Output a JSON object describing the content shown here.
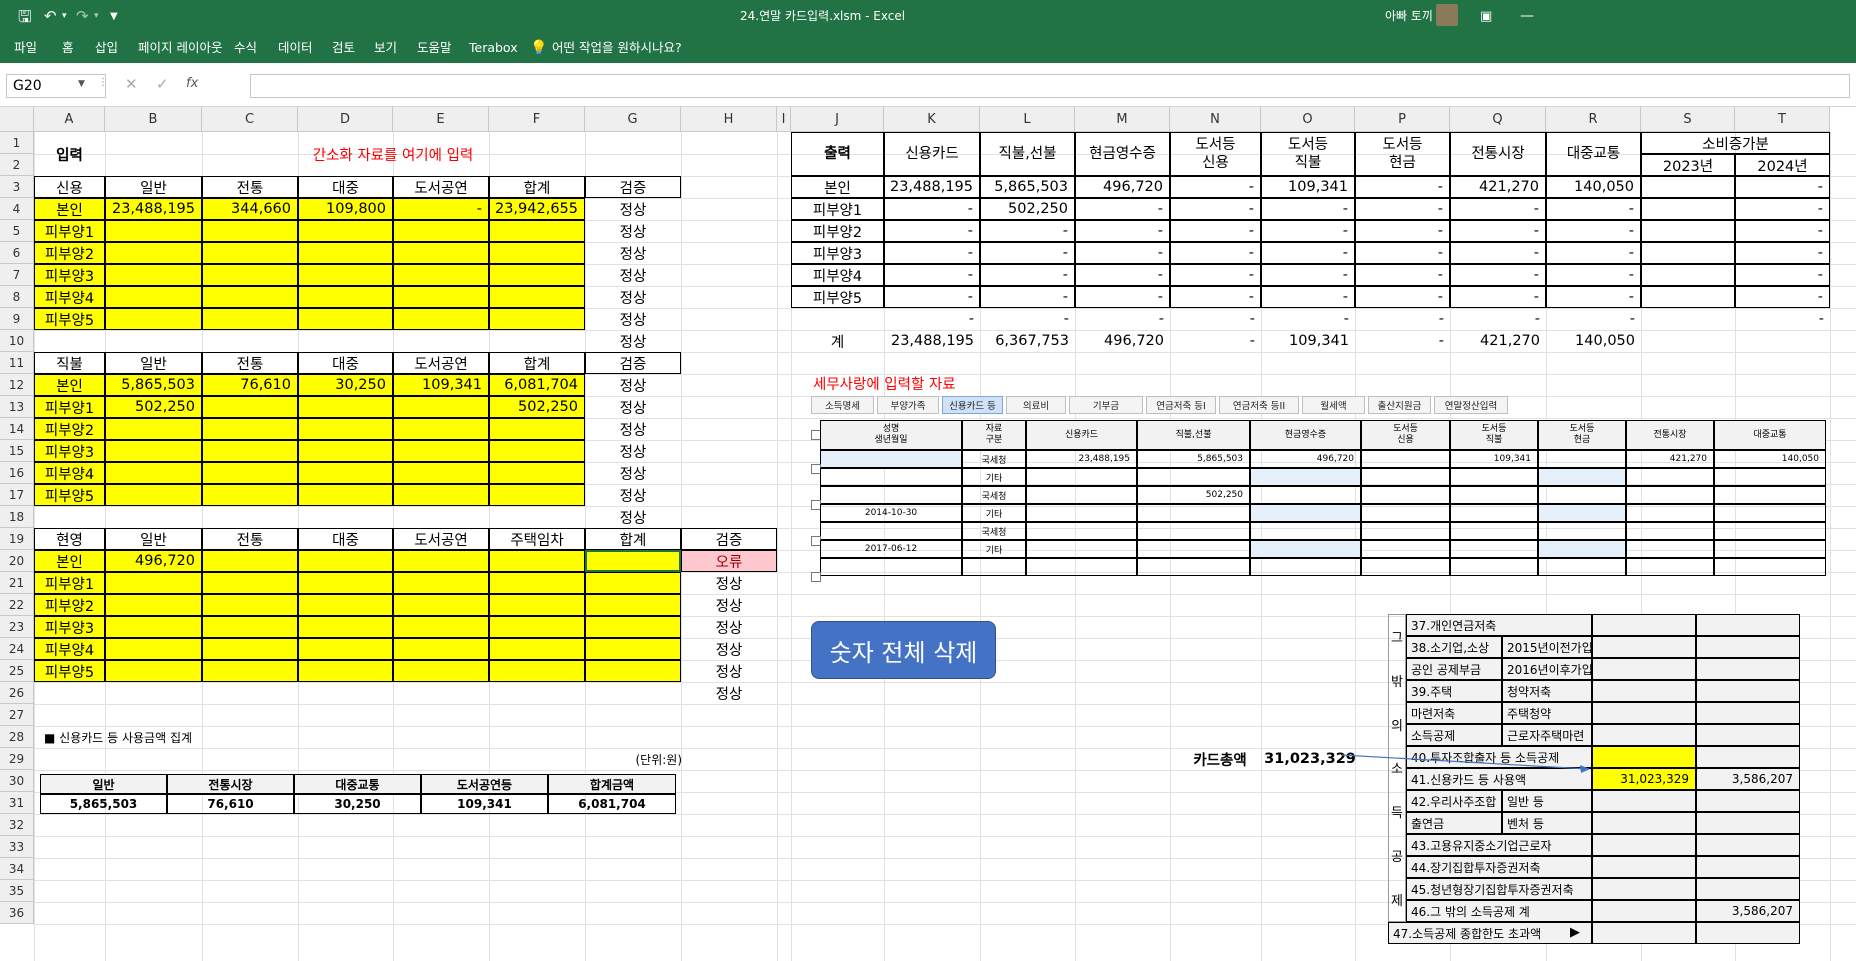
{
  "window": {
    "filename": "24.연말 카드입력.xlsm - Excel",
    "user": "아빠 토끼"
  },
  "ribbon": {
    "tabs": [
      "파일",
      "홈",
      "삽입",
      "페이지 레이아웃",
      "수식",
      "데이터",
      "검토",
      "보기",
      "도움말",
      "Terabox"
    ],
    "tell_me": "어떤 작업을 원하시나요?"
  },
  "formula_bar": {
    "name_box": "G20",
    "fx": "fx",
    "value": ""
  },
  "columns": [
    "A",
    "B",
    "C",
    "D",
    "E",
    "F",
    "G",
    "H",
    "I",
    "J",
    "K",
    "L",
    "M",
    "N",
    "O",
    "P",
    "Q",
    "R",
    "S",
    "T"
  ],
  "rows": [
    "1",
    "2",
    "3",
    "4",
    "5",
    "6",
    "7",
    "8",
    "9",
    "10",
    "11",
    "12",
    "13",
    "14",
    "15",
    "16",
    "17",
    "18",
    "19",
    "20",
    "21",
    "22",
    "23",
    "24",
    "25",
    "26",
    "27",
    "28",
    "29",
    "30",
    "31",
    "32",
    "33",
    "34",
    "35",
    "36"
  ],
  "left": {
    "title_label": "입력",
    "title_note": "간소화 자료를 여기에 입력",
    "t1": {
      "headers": [
        "신용",
        "일반",
        "전통",
        "대중",
        "도서공연",
        "합계",
        "검증"
      ],
      "rows": [
        [
          "본인",
          "23,488,195",
          "344,660",
          "109,800",
          "-",
          "23,942,655",
          "정상"
        ],
        [
          "피부양1",
          "",
          "",
          "",
          "",
          "",
          "정상"
        ],
        [
          "피부양2",
          "",
          "",
          "",
          "",
          "",
          "정상"
        ],
        [
          "피부양3",
          "",
          "",
          "",
          "",
          "",
          "정상"
        ],
        [
          "피부양4",
          "",
          "",
          "",
          "",
          "",
          "정상"
        ],
        [
          "피부양5",
          "",
          "",
          "",
          "",
          "",
          "정상"
        ]
      ],
      "extra": "정상"
    },
    "t2": {
      "headers": [
        "직불",
        "일반",
        "전통",
        "대중",
        "도서공연",
        "합계",
        "검증"
      ],
      "rows": [
        [
          "본인",
          "5,865,503",
          "76,610",
          "30,250",
          "109,341",
          "6,081,704",
          "정상"
        ],
        [
          "피부양1",
          "502,250",
          "",
          "",
          "",
          "502,250",
          "정상"
        ],
        [
          "피부양2",
          "",
          "",
          "",
          "",
          "",
          "정상"
        ],
        [
          "피부양3",
          "",
          "",
          "",
          "",
          "",
          "정상"
        ],
        [
          "피부양4",
          "",
          "",
          "",
          "",
          "",
          "정상"
        ],
        [
          "피부양5",
          "",
          "",
          "",
          "",
          "",
          "정상"
        ]
      ],
      "extra": "정상"
    },
    "t3": {
      "headers": [
        "현영",
        "일반",
        "전통",
        "대중",
        "도서공연",
        "주택임차",
        "합계",
        "검증"
      ],
      "rows": [
        [
          "본인",
          "496,720",
          "",
          "",
          "",
          "",
          "",
          "오류"
        ],
        [
          "피부양1",
          "",
          "",
          "",
          "",
          "",
          "",
          "정상"
        ],
        [
          "피부양2",
          "",
          "",
          "",
          "",
          "",
          "",
          "정상"
        ],
        [
          "피부양3",
          "",
          "",
          "",
          "",
          "",
          "",
          "정상"
        ],
        [
          "피부양4",
          "",
          "",
          "",
          "",
          "",
          "",
          "정상"
        ],
        [
          "피부양5",
          "",
          "",
          "",
          "",
          "",
          "",
          "정상"
        ]
      ],
      "extra": "정상"
    },
    "summary": {
      "title": "■ 신용카드 등 사용금액 집계",
      "unit": "(단위:원)",
      "headers": [
        "일반",
        "전통시장",
        "대중교통",
        "도서공연등",
        "합계금액"
      ],
      "values": [
        "5,865,503",
        "76,610",
        "30,250",
        "109,341",
        "6,081,704"
      ]
    }
  },
  "right": {
    "headers": [
      "출력",
      "신용카드",
      "직불,선불",
      "현금영수증",
      "도서등\n신용",
      "도서등\n직불",
      "도서등\n현금",
      "전통시장",
      "대중교통",
      "소비증가분"
    ],
    "sub_headers": [
      "2023년",
      "2024년"
    ],
    "rows": [
      [
        "본인",
        "23,488,195",
        "5,865,503",
        "496,720",
        "-",
        "109,341",
        "-",
        "421,270",
        "140,050",
        "",
        "-"
      ],
      [
        "피부양1",
        "-",
        "502,250",
        "-",
        "-",
        "-",
        "-",
        "-",
        "-",
        "",
        "-"
      ],
      [
        "피부양2",
        "-",
        "-",
        "-",
        "-",
        "-",
        "-",
        "-",
        "-",
        "",
        "-"
      ],
      [
        "피부양3",
        "-",
        "-",
        "-",
        "-",
        "-",
        "-",
        "-",
        "-",
        "",
        "-"
      ],
      [
        "피부양4",
        "-",
        "-",
        "-",
        "-",
        "-",
        "-",
        "-",
        "-",
        "",
        "-"
      ],
      [
        "피부양5",
        "-",
        "-",
        "-",
        "-",
        "-",
        "-",
        "-",
        "-",
        "",
        "-"
      ],
      [
        "",
        "-",
        "-",
        "-",
        "-",
        "-",
        "-",
        "-",
        "-",
        "",
        "-"
      ],
      [
        "계",
        "23,488,195",
        "6,367,753",
        "496,720",
        "-",
        "109,341",
        "-",
        "421,270",
        "140,050",
        "",
        ""
      ]
    ],
    "tax_title": "세무사랑에 입력할 자료",
    "tax_tabs": [
      "소득명세",
      "부양가족",
      "신용카드 등",
      "의료비",
      "기부금",
      "연금저축 등I",
      "연금저축 등II",
      "월세액",
      "출산지원금",
      "연말정산입력"
    ],
    "tax_headers": [
      "성명\n생년월일",
      "자료\n구분",
      "신용카드",
      "직불,선불",
      "현금영수증",
      "도서등\n신용",
      "도서등\n직불",
      "도서등\n현금",
      "전통시장",
      "대중교통"
    ],
    "tax_rows": [
      [
        "",
        "국세청",
        "23,488,195",
        "5,865,503",
        "496,720",
        "",
        "109,341",
        "",
        "421,270",
        "140,050"
      ],
      [
        "",
        "기타",
        "",
        "",
        "",
        "",
        "",
        "",
        "",
        ""
      ],
      [
        "",
        "국세청",
        "",
        "502,250",
        "",
        "",
        "",
        "",
        "",
        ""
      ],
      [
        "2014-10-30",
        "기타",
        "",
        "",
        "",
        "",
        "",
        "",
        "",
        ""
      ],
      [
        "",
        "국세청",
        "",
        "",
        "",
        "",
        "",
        "",
        "",
        ""
      ],
      [
        "2017-06-12",
        "기타",
        "",
        "",
        "",
        "",
        "",
        "",
        "",
        ""
      ],
      [
        "",
        "",
        "",
        "",
        "",
        "",
        "",
        "",
        "",
        ""
      ]
    ],
    "delete_button": "숫자 전체 삭제",
    "card_total_label": "카드총액",
    "card_total_value": "31,023,329",
    "deduction": {
      "side": [
        "그",
        "밖",
        "의",
        "소",
        "득",
        "공",
        "제"
      ],
      "rows": [
        {
          "a": "37.개인연금저축",
          "b": "",
          "v1": "",
          "v2": ""
        },
        {
          "a": "38.소기업,소상",
          "b": "2015년이전가입",
          "v1": "",
          "v2": ""
        },
        {
          "a": "공인 공제부금",
          "b": "2016년이후가입",
          "v1": "",
          "v2": ""
        },
        {
          "a": "39.주택",
          "b": "청약저축",
          "v1": "",
          "v2": ""
        },
        {
          "a": "마련저축",
          "b": "주택청약",
          "v1": "",
          "v2": ""
        },
        {
          "a": "소득공제",
          "b": "근로자주택마련",
          "v1": "",
          "v2": ""
        },
        {
          "a": "40.투자조합출자 등 소득공제",
          "b": "",
          "v1": "",
          "v2": ""
        },
        {
          "a": "41.신용카드 등 사용액",
          "b": "",
          "v1": "31,023,329",
          "v2": "3,586,207"
        },
        {
          "a": "42.우리사주조합",
          "b": "일반 등",
          "v1": "",
          "v2": ""
        },
        {
          "a": "출연금",
          "b": "벤처 등",
          "v1": "",
          "v2": ""
        },
        {
          "a": "43.고용유지중소기업근로자",
          "b": "",
          "v1": "",
          "v2": ""
        },
        {
          "a": "44.장기집합투자증권저축",
          "b": "",
          "v1": "",
          "v2": ""
        },
        {
          "a": "45.청년형장기집합투자증권저축",
          "b": "",
          "v1": "",
          "v2": ""
        },
        {
          "a": "46.그 밖의 소득공제 계",
          "b": "",
          "v1": "",
          "v2": "3,586,207"
        },
        {
          "a": "47.소득공제 종합한도 초과액",
          "b": "",
          "v1": "",
          "v2": ""
        }
      ]
    }
  }
}
